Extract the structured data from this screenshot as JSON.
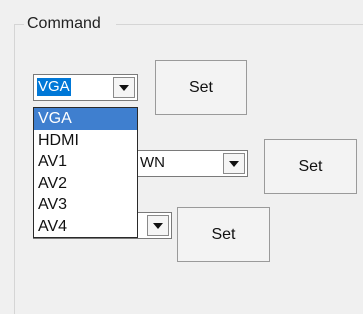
{
  "group": {
    "title": "Command"
  },
  "row1": {
    "combo_value": "VGA",
    "set_label": "Set"
  },
  "row2": {
    "combo_value": "WN",
    "set_label": "Set"
  },
  "row3": {
    "combo_value": "",
    "set_label": "Set"
  },
  "dropdown": {
    "options": [
      "VGA",
      "HDMI",
      "AV1",
      "AV2",
      "AV3",
      "AV4"
    ],
    "highlighted": "VGA"
  },
  "colors": {
    "selection": "#0078d7",
    "highlight": "#3f7fcf"
  },
  "icons": {
    "combo_arrow": "chevron-down-icon"
  }
}
